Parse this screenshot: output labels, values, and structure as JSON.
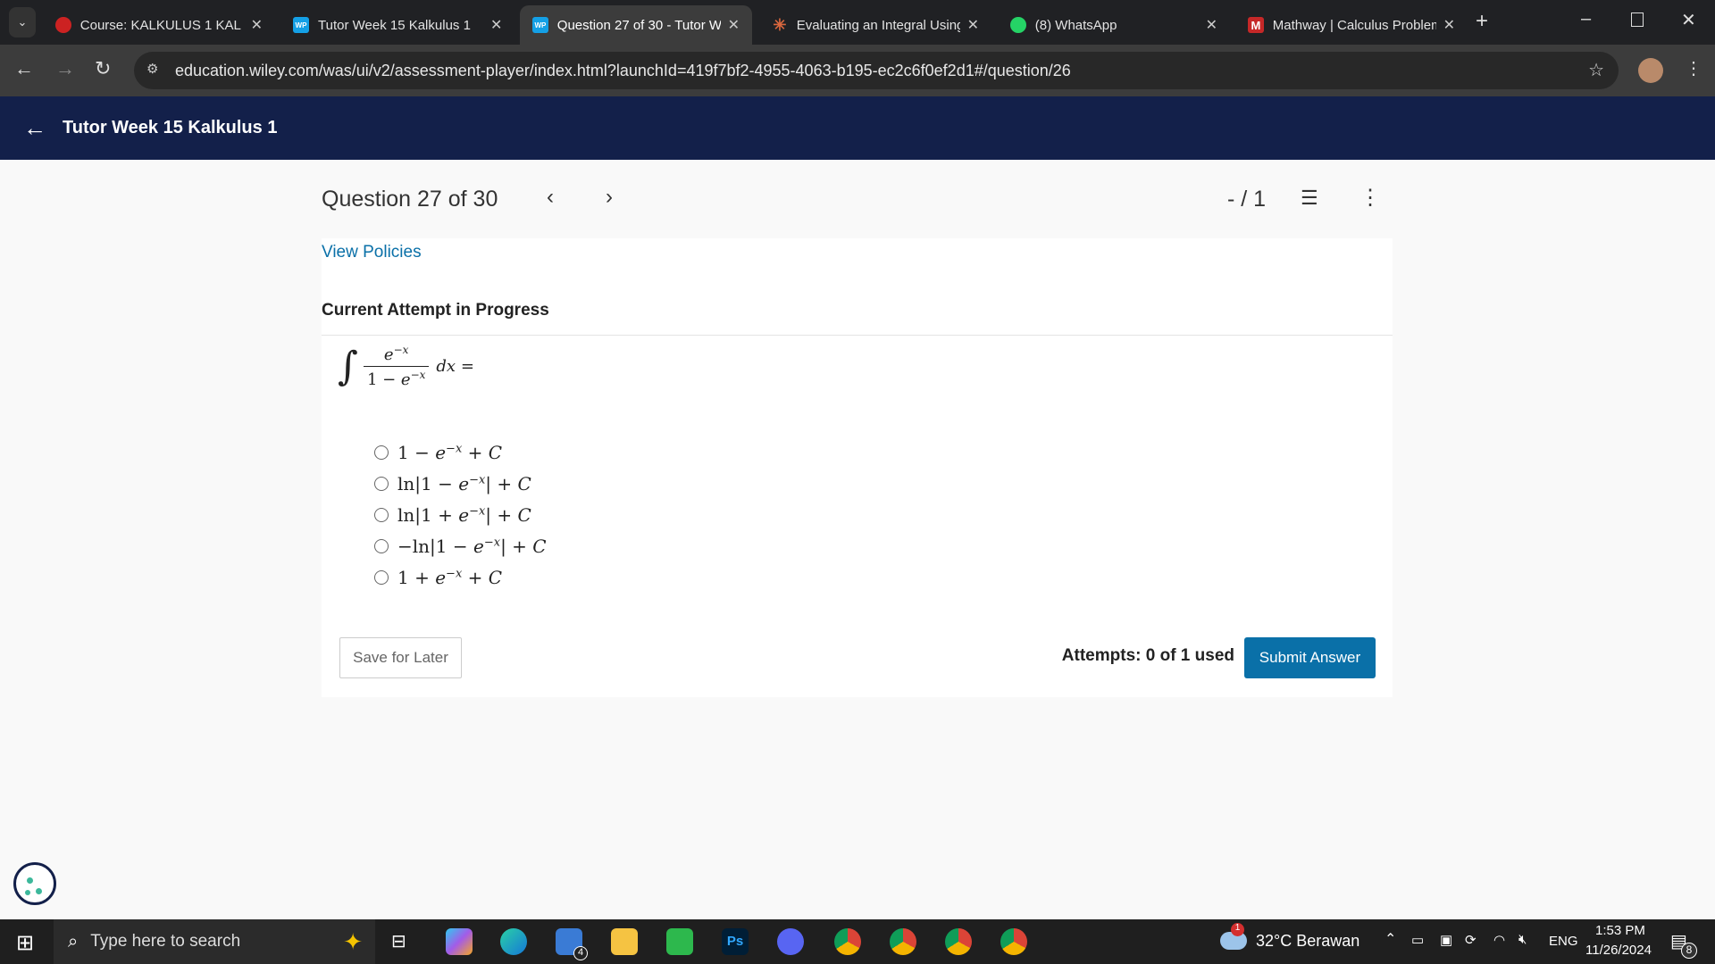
{
  "browser": {
    "tabs": [
      {
        "title": "Course: KALKULUS 1 KAL 3",
        "favicon": "university-logo",
        "active": false
      },
      {
        "title": "Tutor Week 15 Kalkulus 1",
        "favicon": "WP",
        "active": false
      },
      {
        "title": "Question 27 of 30 - Tutor W",
        "favicon": "WP",
        "active": true
      },
      {
        "title": "Evaluating an Integral Using",
        "favicon": "claude-icon",
        "active": false
      },
      {
        "title": "(8) WhatsApp",
        "favicon": "whatsapp-icon",
        "active": false
      },
      {
        "title": "Mathway | Calculus Problem",
        "favicon": "M",
        "active": false
      }
    ],
    "url": "education.wiley.com/was/ui/v2/assessment-player/index.html?launchId=419f7bf2-4955-4063-b195-ec2c6f0ef2d1#/question/26"
  },
  "header": {
    "title": "Tutor Week 15 Kalkulus 1",
    "bg": "#13204a"
  },
  "question": {
    "label": "Question 27 of 30",
    "score": "- / 1",
    "view_policies": "View Policies",
    "attempt_heading": "Current Attempt in Progress",
    "options": [
      "1 − e^{−x} + C",
      "ln|1 − e^{−x}| + C",
      "ln|1 + e^{−x}| + C",
      "−ln|1 − e^{−x}| + C",
      "1 + e^{−x} + C"
    ],
    "save_label": "Save for Later",
    "attempts": "Attempts: 0 of 1 used",
    "submit_label": "Submit Answer",
    "accent": "#0a70a8"
  },
  "taskbar": {
    "search_placeholder": "Type here to search",
    "mail_badge": "4",
    "weather_badge": "1",
    "weather": "32°C  Berawan",
    "lang": "ENG",
    "time": "1:53 PM",
    "date": "11/26/2024",
    "notif_count": "8"
  }
}
